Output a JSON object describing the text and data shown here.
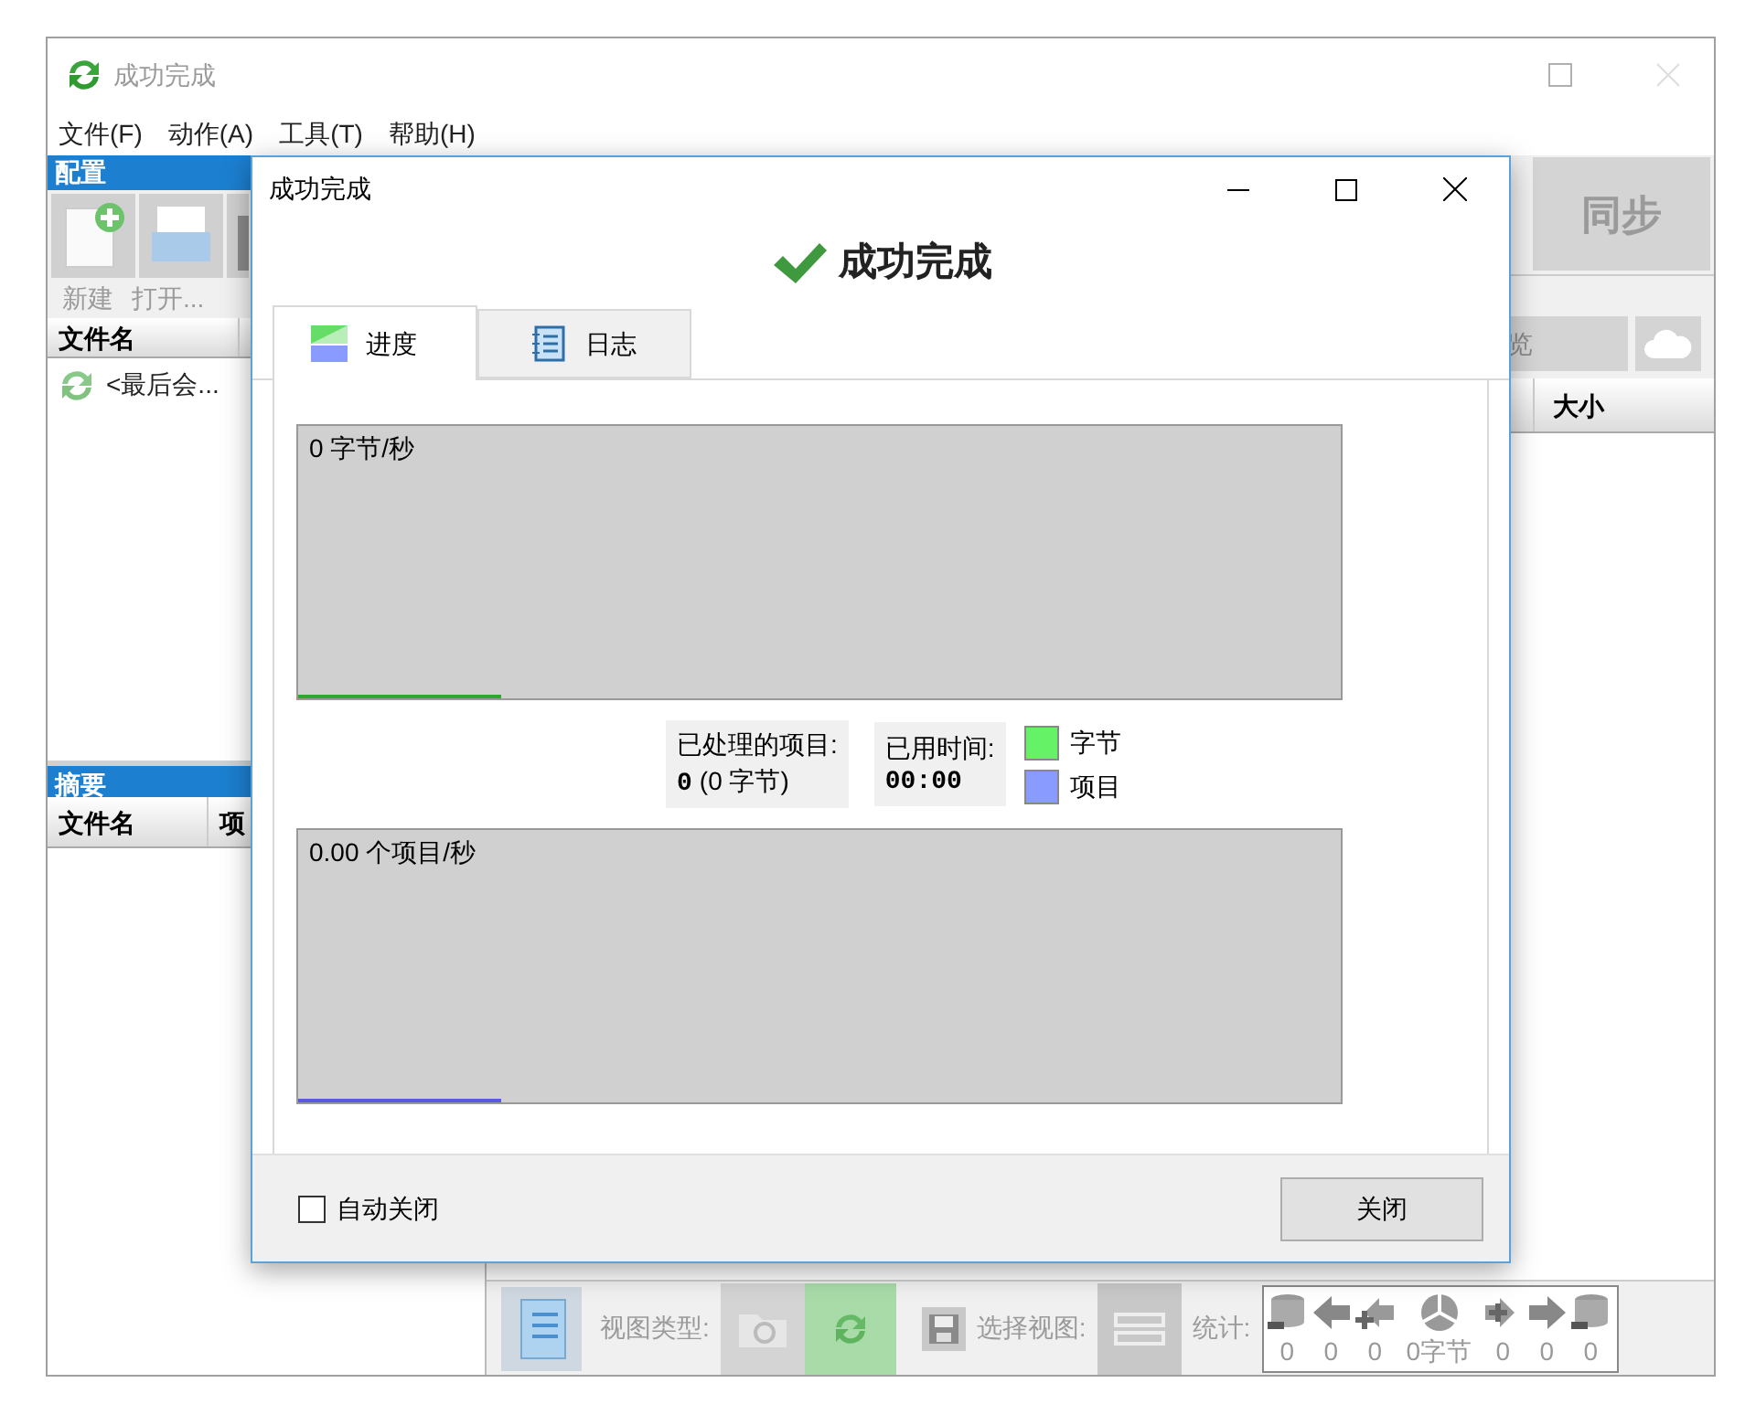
{
  "main_window": {
    "title": "成功完成",
    "menu": [
      "文件(F)",
      "动作(A)",
      "工具(T)",
      "帮助(H)"
    ],
    "config_panel": {
      "title": "配置",
      "tools": [
        "新建",
        "打开..."
      ],
      "columns": [
        "文件名"
      ],
      "rows": [
        "<最后会..."
      ]
    },
    "summary_panel": {
      "title": "摘要",
      "columns": [
        "文件名",
        "项"
      ]
    },
    "sync_button": "同步",
    "browse_button": "览",
    "file_columns": [
      "大小"
    ],
    "bottom_toolbar": {
      "view_type_label": "视图类型:",
      "select_view_label": "选择视图:",
      "stats_label": "统计:",
      "stats": [
        {
          "kind": "db-minus",
          "value": "0"
        },
        {
          "kind": "arrow-left",
          "value": "0"
        },
        {
          "kind": "plus-left",
          "value": "0"
        },
        {
          "kind": "pie",
          "value": "0字节"
        },
        {
          "kind": "plus-right",
          "value": "0"
        },
        {
          "kind": "arrow-right",
          "value": "0"
        },
        {
          "kind": "db-minus",
          "value": "0"
        }
      ]
    }
  },
  "dialog": {
    "title": "成功完成",
    "heading": "成功完成",
    "tabs": [
      {
        "label": "进度",
        "selected": true,
        "kind": "progress"
      },
      {
        "label": "日志",
        "selected": false,
        "kind": "log"
      }
    ],
    "bytes_graph": {
      "label": "0 字节/秒"
    },
    "items_graph": {
      "label": "0.00 个项目/秒"
    },
    "processed": {
      "label": "已处理的项目:",
      "count": "0",
      "bytes": "(0 字节)"
    },
    "elapsed": {
      "label": "已用时间:",
      "value": "00:00"
    },
    "legend": [
      {
        "label": "字节",
        "color": "#66f266"
      },
      {
        "label": "项目",
        "color": "#8a9bff"
      }
    ],
    "auto_close": {
      "label": "自动关闭",
      "checked": false
    },
    "close_button": "关闭"
  }
}
